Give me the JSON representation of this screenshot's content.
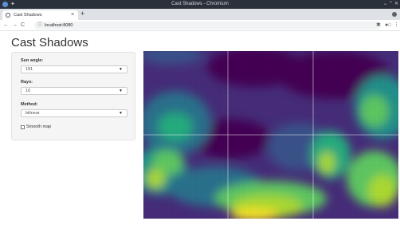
{
  "window": {
    "title": "Cast Shadows - Chromium"
  },
  "tab": {
    "title": "Cast Shadows",
    "close": "×",
    "new_tab": "+"
  },
  "toolbar": {
    "back": "←",
    "forward": "→",
    "reload": "C",
    "info_icon": "ⓘ",
    "url": "localhost:8080",
    "star_icon": "☆"
  },
  "page": {
    "title": "Cast Shadows",
    "controls": {
      "sun_angle": {
        "label": "Sun angle:",
        "value": "181"
      },
      "rays": {
        "label": "Rays:",
        "value": "16"
      },
      "method": {
        "label": "Method:",
        "value": "bilinear"
      },
      "smooth": {
        "label": "Smooth map",
        "checked": false
      }
    }
  },
  "colors": {
    "viridis": [
      "#440154",
      "#472d7b",
      "#3b528b",
      "#2c728e",
      "#21918c",
      "#28ae80",
      "#5ec962",
      "#addc30",
      "#fde725"
    ]
  }
}
